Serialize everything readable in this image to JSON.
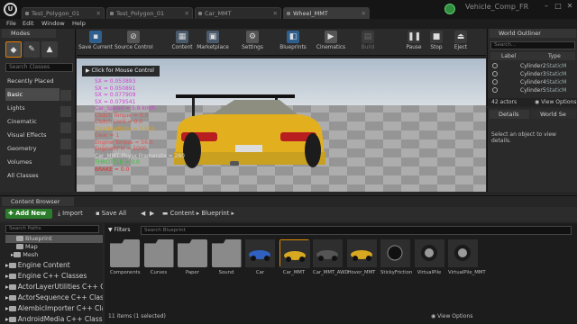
{
  "window": {
    "logo": "U",
    "tabs": [
      {
        "label": "Test_Polygon_01",
        "active": false
      },
      {
        "label": "Test_Polygon_01",
        "active": false
      },
      {
        "label": "Car_MMT",
        "active": false
      },
      {
        "label": "Wheel_MMT",
        "active": true
      }
    ],
    "project_name": "Vehicle_Comp_FR",
    "controls": {
      "minimize": "–",
      "maximize": "□",
      "close": "✕"
    }
  },
  "menu": {
    "items": [
      "File",
      "Edit",
      "Window",
      "Help"
    ]
  },
  "modes": {
    "title": "Modes",
    "search_placeholder": "Search Classes",
    "categories": [
      "Recently Placed",
      "Basic",
      "Lights",
      "Cinematic",
      "Visual Effects",
      "Geometry",
      "Volumes",
      "All Classes"
    ],
    "active_category": "Basic"
  },
  "toolbar": {
    "buttons": [
      {
        "label": "Save Current",
        "icon": "save-icon",
        "enabled": true
      },
      {
        "label": "Source Control",
        "icon": "source-control-icon",
        "enabled": true
      },
      {
        "label": "Content",
        "icon": "content-icon",
        "enabled": true
      },
      {
        "label": "Marketplace",
        "icon": "marketplace-icon",
        "enabled": true
      },
      {
        "label": "Settings",
        "icon": "settings-icon",
        "enabled": true
      },
      {
        "label": "Blueprints",
        "icon": "blueprints-icon",
        "enabled": true
      },
      {
        "label": "Cinematics",
        "icon": "cinematics-icon",
        "enabled": true
      },
      {
        "label": "Build",
        "icon": "build-icon",
        "enabled": false
      },
      {
        "label": "Pause",
        "icon": "pause-icon",
        "enabled": true
      },
      {
        "label": "Stop",
        "icon": "stop-icon",
        "enabled": true
      },
      {
        "label": "Eject",
        "icon": "eject-icon",
        "enabled": true
      }
    ]
  },
  "viewport": {
    "mouse_control_label": "Click for Mouse Control",
    "stats": [
      {
        "text": "SX = 0.053893",
        "color": "#d040d0"
      },
      {
        "text": "SX = 0.050891",
        "color": "#d040d0"
      },
      {
        "text": "SX = 0.077909",
        "color": "#d040d0"
      },
      {
        "text": "SX = 0.079541",
        "color": "#d040d0"
      },
      {
        "text": "Car_Speed = 5.8 km/h",
        "color": "#d040d0"
      },
      {
        "text": "Clutch Torque = 0.0",
        "color": "#e05050"
      },
      {
        "text": "Clutch Lock = 0.0",
        "color": "#e05050"
      },
      {
        "text": "GearboxRatio = 3.626",
        "color": "#d8a020"
      },
      {
        "text": "Gear = 1",
        "color": "#e05050"
      },
      {
        "text": "Engine Torque = 56.5",
        "color": "#e05050"
      },
      {
        "text": "EngineRPM = 1000",
        "color": "#e05050"
      },
      {
        "text": "Car_MMT   Physx Framerate = 280",
        "color": "#d8d8d8"
      },
      {
        "text": "THROTTLE = 0.0",
        "color": "#30c030"
      },
      {
        "text": "BRAKE = 0.0",
        "color": "#e03030"
      }
    ]
  },
  "outliner": {
    "title": "World Outliner",
    "search_placeholder": "Search...",
    "columns": [
      "Label",
      "Type"
    ],
    "rows": [
      {
        "label": "Cylinder2",
        "type": "StaticM"
      },
      {
        "label": "Cylinder3",
        "type": "StaticM"
      },
      {
        "label": "Cylinder4",
        "type": "StaticM"
      },
      {
        "label": "Cylinder5",
        "type": "StaticM"
      }
    ],
    "actor_count": "42 actors",
    "view_options": "View Options"
  },
  "details": {
    "tab_details": "Details",
    "tab_world": "World Se",
    "hint": "Select an object to view details."
  },
  "content_browser": {
    "title": "Content Browser",
    "add_new": "Add New",
    "import": "Import",
    "save_all": "Save All",
    "path": [
      "Content",
      "Blueprint"
    ],
    "tree_search_placeholder": "Search Paths",
    "tree": [
      {
        "label": "Blueprint",
        "selected": true,
        "big": false
      },
      {
        "label": "Map",
        "selected": false,
        "big": false
      },
      {
        "label": "Mesh",
        "selected": false,
        "big": false
      },
      {
        "label": "Engine Content",
        "selected": false,
        "big": true
      },
      {
        "label": "Engine C++ Classes",
        "selected": false,
        "big": true
      },
      {
        "label": "ActorLayerUtilities C++ C",
        "selected": false,
        "big": true
      },
      {
        "label": "ActorSequence C++ Class",
        "selected": false,
        "big": true
      },
      {
        "label": "AlembicImporter C++ Cla",
        "selected": false,
        "big": true
      },
      {
        "label": "AndroidMedia C++ Class",
        "selected": false,
        "big": true
      },
      {
        "label": "AndroidPermission C++ C",
        "selected": false,
        "big": true
      }
    ],
    "filters_label": "Filters",
    "asset_search_placeholder": "Search Blueprint",
    "assets": [
      {
        "name": "Components",
        "kind": "folder",
        "selected": false
      },
      {
        "name": "Curves",
        "kind": "folder",
        "selected": false
      },
      {
        "name": "Paper",
        "kind": "folder",
        "selected": false
      },
      {
        "name": "Sound",
        "kind": "folder",
        "selected": false
      },
      {
        "name": "Car",
        "kind": "car-blue",
        "selected": false
      },
      {
        "name": "Car_MMT",
        "kind": "car-yellow",
        "selected": true
      },
      {
        "name": "Car_MMT_AWD",
        "kind": "car-dark",
        "selected": false
      },
      {
        "name": "Hover_MMT",
        "kind": "car-yellow",
        "selected": false
      },
      {
        "name": "StickyFriction",
        "kind": "sphere",
        "selected": false
      },
      {
        "name": "VirtualPile",
        "kind": "wheel",
        "selected": false
      },
      {
        "name": "VirtualPile_MMT",
        "kind": "wheel",
        "selected": false
      }
    ],
    "status": "11 items (1 selected)",
    "view_options": "View Options"
  }
}
